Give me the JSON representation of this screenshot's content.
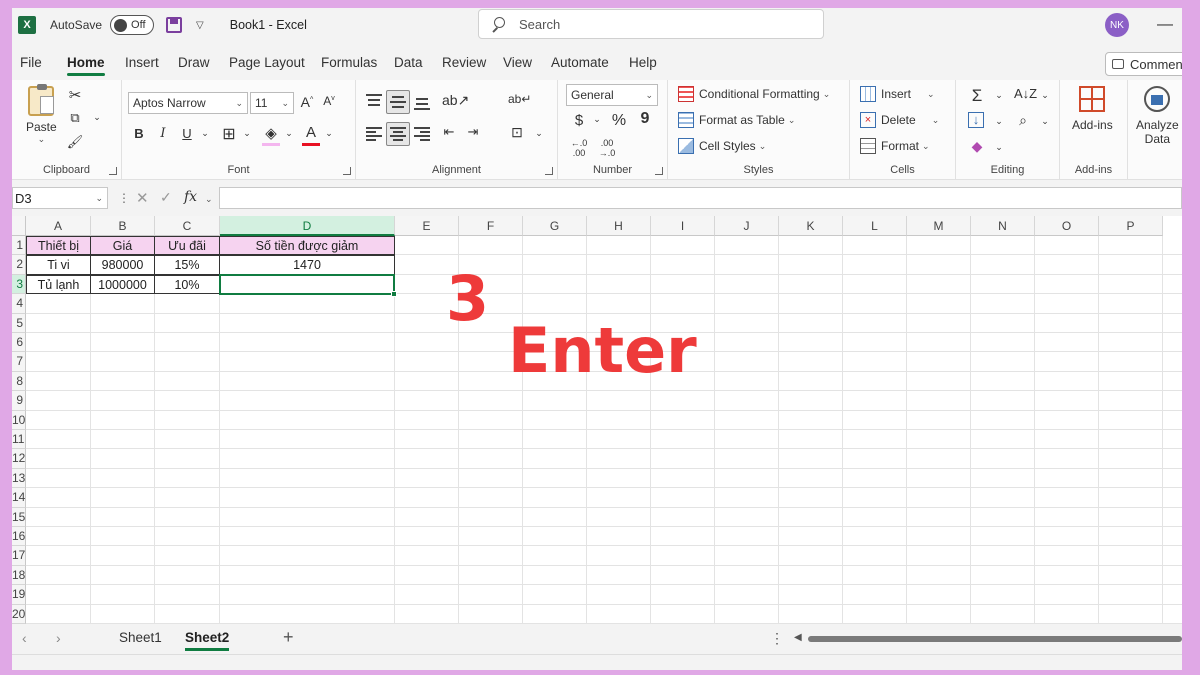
{
  "titlebar": {
    "app_icon": "X",
    "autosave_label": "AutoSave",
    "autosave_state": "Off",
    "doc_title": "Book1  -  Excel",
    "search_placeholder": "Search",
    "avatar_initials": "NK",
    "minimize": "—"
  },
  "menu": {
    "tabs": [
      "File",
      "Home",
      "Insert",
      "Draw",
      "Page Layout",
      "Formulas",
      "Data",
      "Review",
      "View",
      "Automate",
      "Help"
    ],
    "active": "Home",
    "comments_label": "Comments"
  },
  "ribbon": {
    "clipboard": {
      "label": "Clipboard",
      "paste": "Paste"
    },
    "font": {
      "label": "Font",
      "font_name": "Aptos Narrow",
      "font_size": "11",
      "bold": "B",
      "italic": "I",
      "underline": "U"
    },
    "alignment": {
      "label": "Alignment"
    },
    "number": {
      "label": "Number",
      "format": "General",
      "currency": "$",
      "percent": "%",
      "comma": "9"
    },
    "styles": {
      "label": "Styles",
      "conditional": "Conditional Formatting",
      "format_table": "Format as Table",
      "cell_styles": "Cell Styles"
    },
    "cells": {
      "label": "Cells",
      "insert": "Insert",
      "delete": "Delete",
      "format": "Format"
    },
    "editing": {
      "label": "Editing"
    },
    "addins": {
      "label": "Add-ins",
      "button": "Add-ins"
    },
    "analyze": {
      "line1": "Analyze",
      "line2": "Data"
    }
  },
  "formula_bar": {
    "name_box": "D3",
    "fx": "fx",
    "value": ""
  },
  "grid": {
    "columns": [
      "A",
      "B",
      "C",
      "D",
      "E",
      "F",
      "G",
      "H",
      "I",
      "J",
      "K",
      "L",
      "M",
      "N",
      "O",
      "P"
    ],
    "selected_column": "D",
    "rows": [
      "1",
      "2",
      "3",
      "4",
      "5",
      "6",
      "7",
      "8",
      "9",
      "10",
      "11",
      "12",
      "13",
      "14",
      "15",
      "16",
      "17",
      "18",
      "19",
      "20"
    ],
    "selected_row": "3",
    "table": {
      "header": [
        "Thiết bị",
        "Giá",
        "Ưu đãi",
        "Số tiền được giảm"
      ],
      "rows": [
        [
          "Ti vi",
          "980000",
          "15%",
          "1470"
        ],
        [
          "Tủ lạnh",
          "1000000",
          "10%",
          ""
        ]
      ]
    }
  },
  "overlay": {
    "step_number": "3",
    "step_text": "Enter",
    "color": "#ee3a3a"
  },
  "sheets": {
    "tabs": [
      "Sheet1",
      "Sheet2"
    ],
    "active": "Sheet2",
    "add": "+"
  },
  "colors": {
    "accent": "#107c41",
    "header_fill": "#f6d3f0",
    "background": "#e0a8e6"
  }
}
